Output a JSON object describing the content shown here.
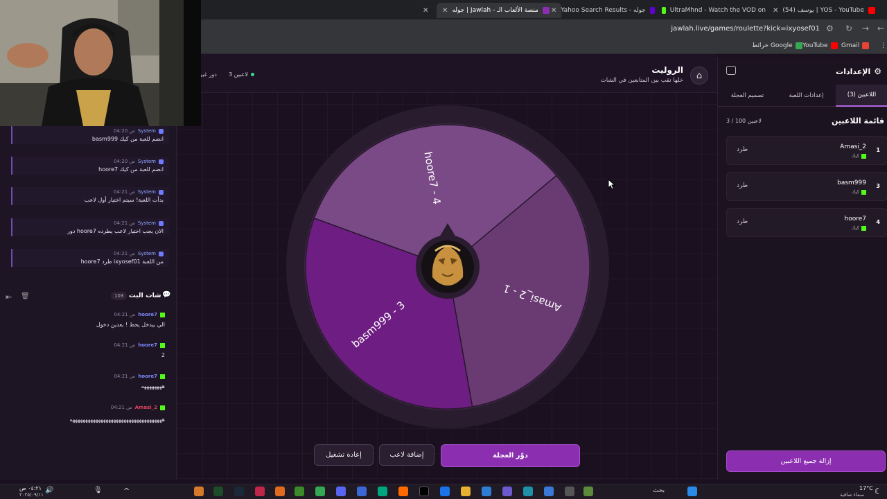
{
  "browser": {
    "tabs": [
      {
        "title": "جوله | Jawlah - منصة الألعاب الـ",
        "active": true
      },
      {
        "title": "Yahoo Search Results - جوله"
      },
      {
        "title": "UltraMhnd - Watch the VOD on"
      },
      {
        "title": "(54) يوسف | YOS - YouTube"
      }
    ],
    "url": "jawlah.live/games/roulette?kick=ixyosef01",
    "bookmarks": [
      "Gmail",
      "YouTube",
      "خرائط Google"
    ]
  },
  "chat": {
    "system_messages": [
      {
        "user": "System",
        "time": "04:20 ص",
        "text": "basm999 انضم للعبة من كيك"
      },
      {
        "user": "System",
        "time": "04:20 ص",
        "text": "hoore7 انضم للعبة من كيك"
      },
      {
        "user": "System",
        "time": "04:21 ص",
        "text": "بدأت اللعبة! سيتم اختيار أول لاعب"
      },
      {
        "user": "System",
        "time": "04:21 ص",
        "text": "دور hoore7 الان يجب اختيار لاعب يطرده"
      },
      {
        "user": "System",
        "time": "04:21 ص",
        "text": "hoore7 طرد ixyosef01 من اللعبة"
      }
    ],
    "stream_chat_title": "شات البث",
    "stream_chat_count": "103",
    "messages": [
      {
        "user": "hoore7",
        "time": "04:21 ص",
        "text": "الي بيدخل يحط ! بعدين دخول"
      },
      {
        "user": "hoore7",
        "time": "04:21 ص",
        "text": "2"
      },
      {
        "user": "hoore7",
        "time": "04:21 ص",
        "text": "ههههههههه"
      },
      {
        "user": "Amasi_2",
        "time": "04:21 ص",
        "text": "ههههههههههههههههههههههههههههههههههههه"
      }
    ]
  },
  "header": {
    "title": "الروليت",
    "subtitle": "خلها تقب بين المتابعين في الشات",
    "players_count": "3 لاعبين",
    "turn_label": "دور غير"
  },
  "wheel": {
    "segments": [
      {
        "label": "hoore7 - 4",
        "color": "#7a4a86"
      },
      {
        "label": "Amasi_2 - 1",
        "color": "#6a3b73"
      },
      {
        "label": "basm999 - 3",
        "color": "#6e1d82"
      }
    ]
  },
  "buttons": {
    "spin": "دوّر العجلة",
    "add_player": "إضافة لاعب",
    "restart": "إعادة تشغيل"
  },
  "settings": {
    "title": "الإعدادات",
    "tabs": [
      "اللاعبين (3)",
      "إعدادات اللعبة",
      "تصميم العجلة"
    ],
    "list_title": "قائمة اللاعبين",
    "list_count": "3 / 100 لاعبين",
    "players": [
      {
        "num": "1",
        "name": "Amasi_2",
        "platform": "كيك",
        "action": "طرد"
      },
      {
        "num": "3",
        "name": "basm999",
        "platform": "كيك",
        "action": "طرد"
      },
      {
        "num": "4",
        "name": "hoore7",
        "platform": "كيك",
        "action": "طرد"
      }
    ],
    "remove_all": "إزالة جميع اللاعبين"
  },
  "taskbar": {
    "search_placeholder": "بحث",
    "weather_temp": "17°C",
    "weather_desc": "سماء صافية",
    "time": "٠٤:٢١ ص",
    "date": "٢٠٢٥/٠٩/١١"
  }
}
